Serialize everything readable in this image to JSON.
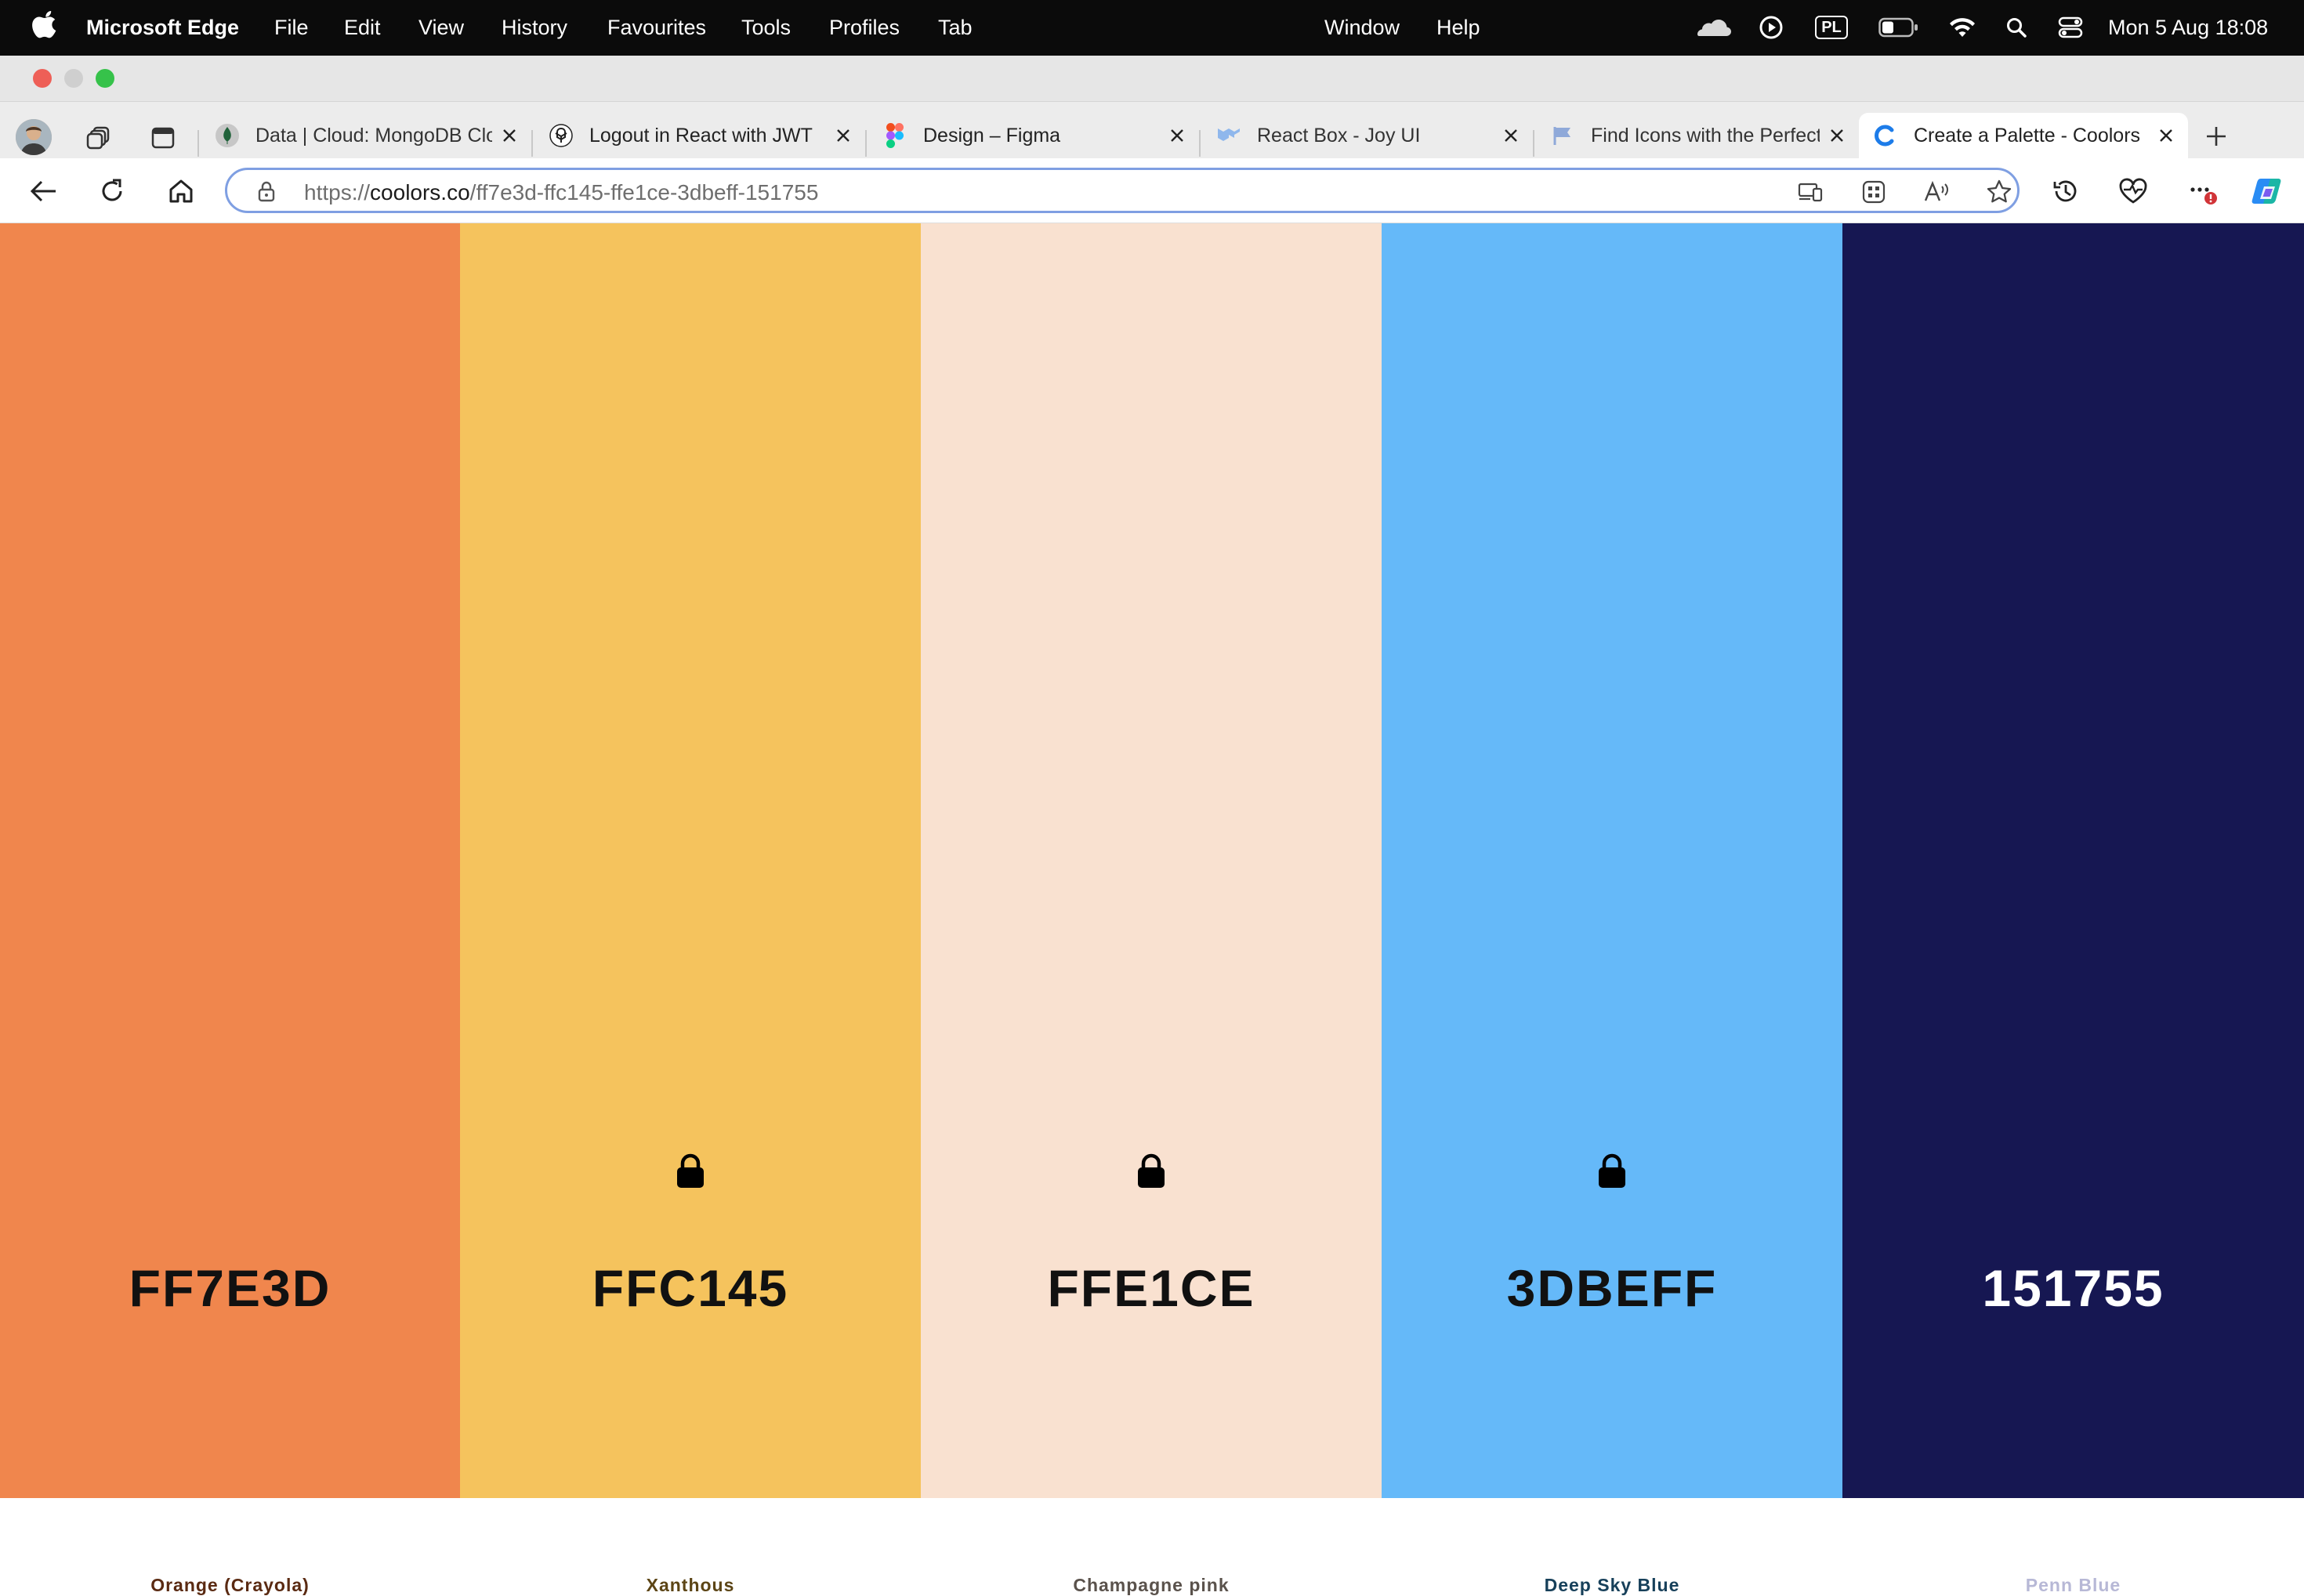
{
  "menubar": {
    "app_name": "Microsoft Edge",
    "items": [
      "File",
      "Edit",
      "View",
      "History",
      "Favourites",
      "Tools",
      "Profiles",
      "Tab"
    ],
    "right_items": [
      "Window",
      "Help"
    ],
    "input_source": "PL",
    "clock": "Mon 5 Aug  18:08"
  },
  "tabs": [
    {
      "title": "Data | Cloud: MongoDB Cloud",
      "icon": "mongodb-leaf-icon",
      "active": false
    },
    {
      "title": "Logout in React with JWT",
      "icon": "chatgpt-icon",
      "active": false
    },
    {
      "title": "Design – Figma",
      "icon": "figma-icon",
      "active": false
    },
    {
      "title": "React Box - Joy UI",
      "icon": "mui-icon",
      "active": false
    },
    {
      "title": "Find Icons with the Perfect Look & Feel",
      "icon": "flag-icon",
      "active": false
    },
    {
      "title": "Create a Palette - Coolors",
      "icon": "coolors-icon",
      "active": true
    }
  ],
  "address": {
    "scheme": "https://",
    "host": "coolors.co",
    "path": "/ff7e3d-ffc145-ffe1ce-3dbeff-151755"
  },
  "palette": [
    {
      "hex": "FF7E3D",
      "name": "Orange (Crayola)",
      "color": "#F0864D",
      "text_color": "#111111",
      "name_color": "#5a2a12",
      "locked": false
    },
    {
      "hex": "FFC145",
      "name": "Xanthous",
      "color": "#F5C35D",
      "text_color": "#111111",
      "name_color": "#5c4516",
      "locked": true
    },
    {
      "hex": "FFE1CE",
      "name": "Champagne pink",
      "color": "#F9E1D0",
      "text_color": "#111111",
      "name_color": "#5a524c",
      "locked": true
    },
    {
      "hex": "3DBEFF",
      "name": "Deep Sky Blue",
      "color": "#65B9F9",
      "text_color": "#111111",
      "name_color": "#17405a",
      "locked": true
    },
    {
      "hex": "151755",
      "name": "Penn Blue",
      "color": "#161752",
      "text_color": "#ffffff",
      "name_color": "#b7b8d6",
      "locked": false
    }
  ]
}
